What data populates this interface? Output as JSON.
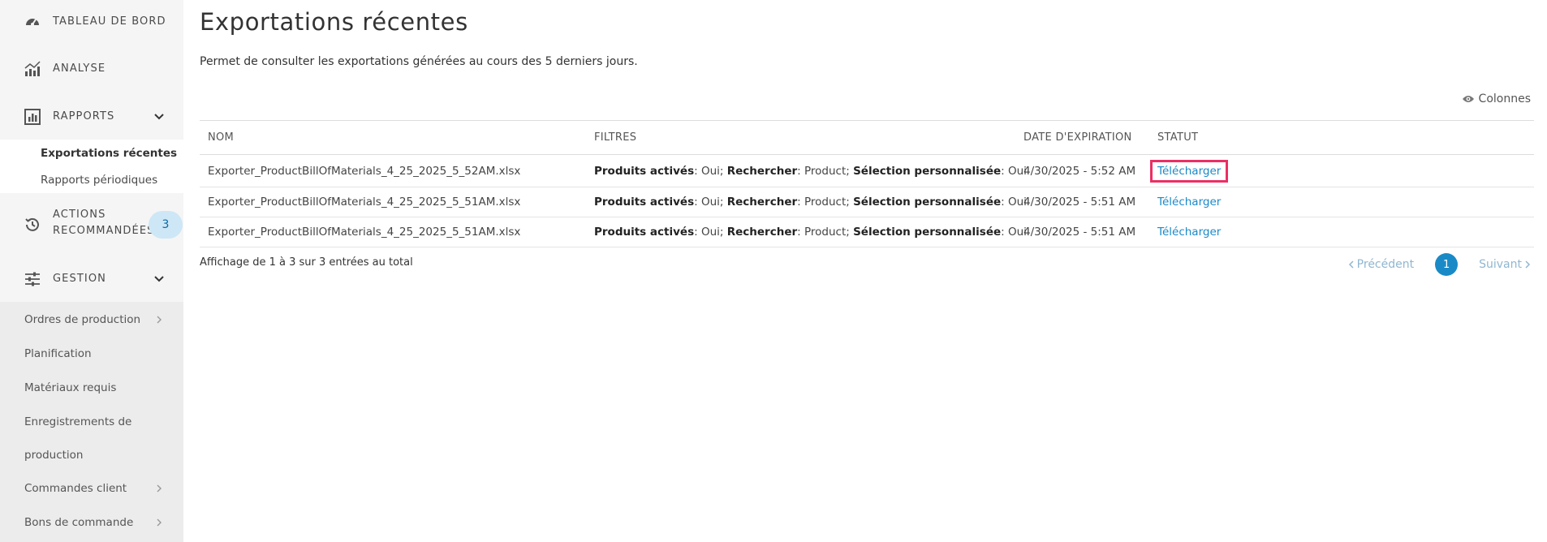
{
  "sidebar": {
    "dashboard": "TABLEAU DE BORD",
    "analysis": "ANALYSE",
    "reports": "RAPPORTS",
    "reports_sub": [
      "Exportations récentes",
      "Rapports périodiques"
    ],
    "actions_line1": "ACTIONS",
    "actions_line2": "RECOMMANDÉES",
    "actions_badge": "3",
    "management": "GESTION",
    "management_sub": {
      "production_orders": "Ordres de production",
      "planning": "Planification",
      "required_materials": "Matériaux requis",
      "production_records_1": "Enregistrements de",
      "production_records_2": "production",
      "customer_orders": "Commandes client",
      "purchase_orders": "Bons de commande"
    }
  },
  "main": {
    "title": "Exportations récentes",
    "description": "Permet de consulter les exportations générées au cours des 5 derniers jours.",
    "columns_button": "Colonnes",
    "table": {
      "headers": {
        "name": "NOM",
        "filters": "FILTRES",
        "expiration": "DATE D'EXPIRATION",
        "status": "STATUT"
      },
      "filter_labels": {
        "activated": "Produits activés",
        "search": "Rechercher",
        "custom": "Sélection personnalisée"
      },
      "rows": [
        {
          "name": "Exporter_ProductBillOfMaterials_4_25_2025_5_52AM.xlsx",
          "activated": ": Oui; ",
          "search": ": Product; ",
          "custom": ": Oui",
          "date": "4/30/2025 - 5:52 AM",
          "status": "Télécharger"
        },
        {
          "name": "Exporter_ProductBillOfMaterials_4_25_2025_5_51AM.xlsx",
          "activated": ": Oui; ",
          "search": ": Product; ",
          "custom": ": Oui",
          "date": "4/30/2025 - 5:51 AM",
          "status": "Télécharger"
        },
        {
          "name": "Exporter_ProductBillOfMaterials_4_25_2025_5_51AM.xlsx",
          "activated": ": Oui; ",
          "search": ": Product; ",
          "custom": ": Oui",
          "date": "4/30/2025 - 5:51 AM",
          "status": "Télécharger"
        }
      ]
    },
    "footer_text": "Affichage de 1 à 3 sur 3 entrées au total",
    "pagination": {
      "prev": "Précédent",
      "current": "1",
      "next": "Suivant"
    }
  },
  "colors": {
    "accent": "#1a8ac7",
    "highlight": "#ea2f64",
    "sidebar_bg": "#f5f5f5",
    "badge_bg": "#cde7f6"
  }
}
